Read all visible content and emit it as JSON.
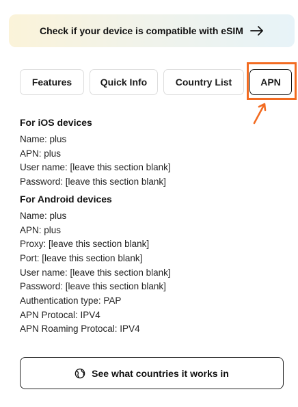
{
  "banner": {
    "label": "Check if your device is compatible with eSIM",
    "icon": "arrow-right-icon"
  },
  "tabs": [
    {
      "label": "Features",
      "selected": false
    },
    {
      "label": "Quick Info",
      "selected": false
    },
    {
      "label": "Country List",
      "selected": false
    },
    {
      "label": "APN",
      "selected": true
    }
  ],
  "annotation": {
    "color": "#f26b21"
  },
  "ios": {
    "heading": "For iOS devices",
    "lines": [
      "Name: plus",
      "APN: plus",
      "User name: [leave this section blank]",
      "Password: [leave this section blank]"
    ]
  },
  "android": {
    "heading": "For Android devices",
    "lines": [
      "Name: plus",
      "APN: plus",
      "Proxy: [leave this section blank]",
      "Port: [leave this section blank]",
      "User name: [leave this section blank]",
      "Password: [leave this section blank]",
      "Authentication type: PAP",
      "APN Protocal: IPV4",
      "APN Roaming Protocal: IPV4"
    ]
  },
  "cta": {
    "label": "See what countries it works in",
    "icon": "globe-icon"
  }
}
